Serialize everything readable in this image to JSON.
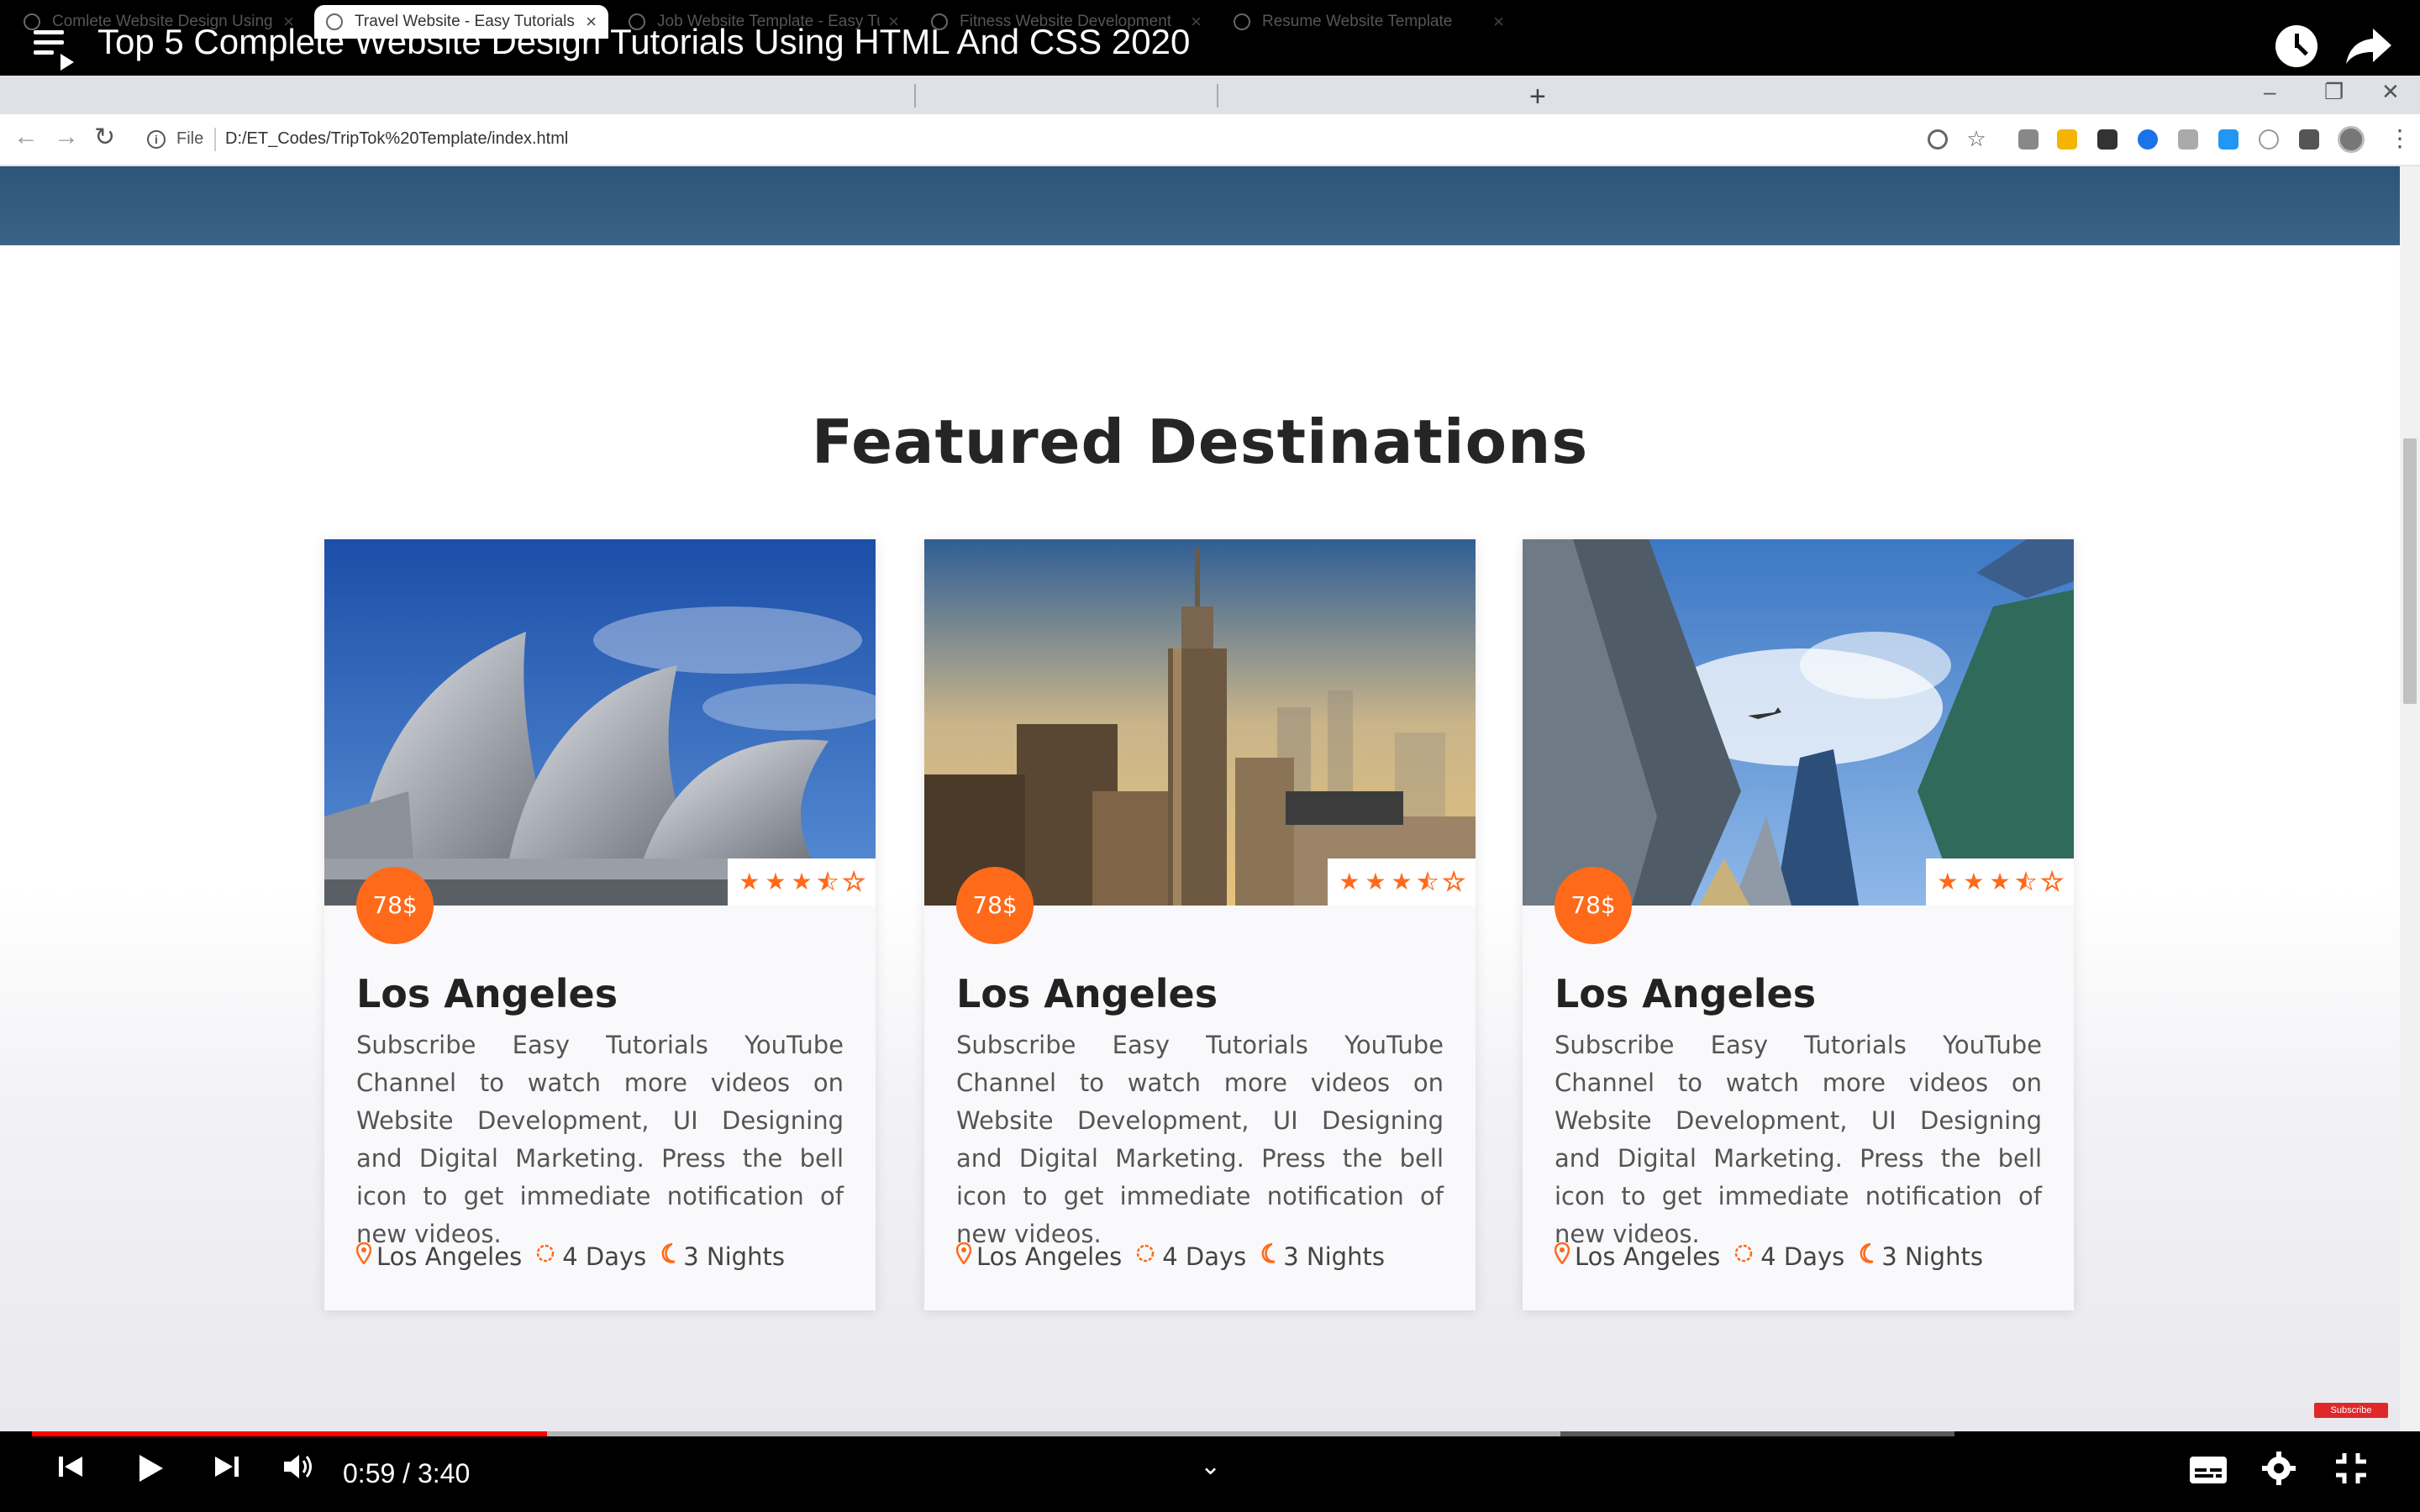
{
  "video": {
    "title": "Top 5 Complete Website Design Tutorials Using HTML And CSS 2020",
    "current_time": "0:59",
    "duration": "3:40",
    "time_display": "0:59 / 3:40",
    "progress_fraction": 0.268,
    "buffered_fraction": 0.795
  },
  "browser": {
    "tabs": [
      {
        "label": "Comlete Website Design Using H",
        "active": false
      },
      {
        "label": "Travel Website - Easy Tutorials",
        "active": true
      },
      {
        "label": "Job Website Template - Easy Tuto",
        "active": false
      },
      {
        "label": "Fitness Website Development",
        "active": false
      },
      {
        "label": "Resume Website Template",
        "active": false
      }
    ],
    "new_tab": "+",
    "close_glyph": "×",
    "scheme_label": "File",
    "url": "D:/ET_Codes/TripTok%20Template/index.html",
    "window_controls": {
      "minimize": "–",
      "restore": "❐",
      "close": "✕"
    },
    "nav": {
      "back": "←",
      "forward": "→",
      "reload": "↻"
    },
    "info_glyph": "i",
    "menu_glyph": "⋮"
  },
  "page": {
    "section_title": "Featured Destinations",
    "cards": [
      {
        "price": "78$",
        "rating": 3.5,
        "title": "Los Angeles",
        "description": "Subscribe Easy Tutorials YouTube Channel to watch more videos on Website Development, UI Designing and Digital Marketing. Press the bell icon to get immediate notification of new videos.",
        "location": "Los Angeles",
        "days": "4 Days",
        "nights": "3 Nights"
      },
      {
        "price": "78$",
        "rating": 3.5,
        "title": "Los Angeles",
        "description": "Subscribe Easy Tutorials YouTube Channel to watch more videos on Website Development, UI Designing and Digital Marketing. Press the bell icon to get immediate notification of new videos.",
        "location": "Los Angeles",
        "days": "4 Days",
        "nights": "3 Nights"
      },
      {
        "price": "78$",
        "rating": 3.5,
        "title": "Los Angeles",
        "description": "Subscribe Easy Tutorials YouTube Channel to watch more videos on Website Development, UI Designing and Digital Marketing. Press the bell icon to get immediate notification of new videos.",
        "location": "Los Angeles",
        "days": "4 Days",
        "nights": "3 Nights"
      }
    ],
    "meta_icons": {
      "location": "location-pin-icon",
      "days": "sun-icon",
      "nights": "moon-icon"
    }
  },
  "watermark": {
    "subscribe_text": "Subscribe"
  },
  "colors": {
    "accent": "#ff6a1a",
    "hero_strip": "#2c5577",
    "progress_played": "#ff0000"
  }
}
